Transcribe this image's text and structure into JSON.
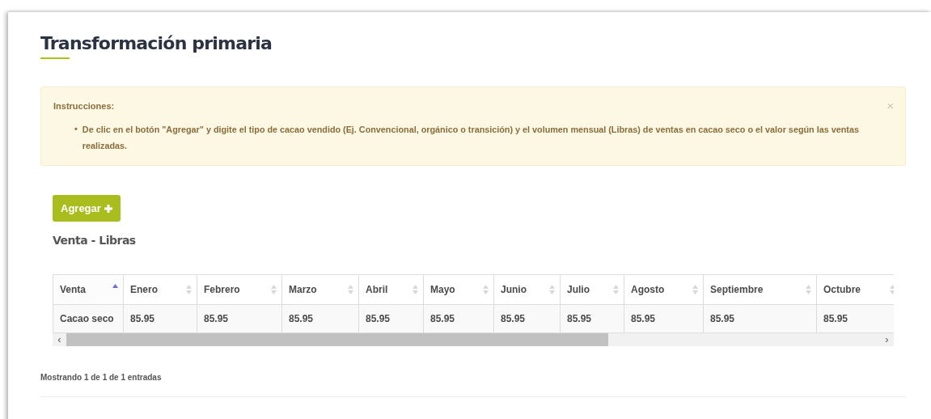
{
  "title": "Transformación primaria",
  "alert": {
    "heading": "Instrucciones:",
    "bullet": "•",
    "items": [
      "De clic en el botón \"Agregar\" y digite el tipo de cacao vendido (Ej. Convencional, orgánico o transición) y el volumen mensual (Libras) de ventas en cacao seco o el valor según las ventas realizadas."
    ],
    "close": "×"
  },
  "add_button": "Agregar",
  "subtitle": "Venta - Libras",
  "table": {
    "columns": [
      {
        "label": "Venta",
        "sorted": true
      },
      {
        "label": "Enero",
        "sorted": false
      },
      {
        "label": "Febrero",
        "sorted": false
      },
      {
        "label": "Marzo",
        "sorted": false
      },
      {
        "label": "Abril",
        "sorted": false
      },
      {
        "label": "Mayo",
        "sorted": false
      },
      {
        "label": "Junio",
        "sorted": false
      },
      {
        "label": "Julio",
        "sorted": false
      },
      {
        "label": "Agosto",
        "sorted": false
      },
      {
        "label": "Septiembre",
        "sorted": false
      },
      {
        "label": "Octubre",
        "sorted": false
      }
    ],
    "rows": [
      [
        "Cacao seco",
        "85.95",
        "85.95",
        "85.95",
        "85.95",
        "85.95",
        "85.95",
        "85.95",
        "85.95",
        "85.95",
        "85.95"
      ]
    ]
  },
  "scroll_left": "‹",
  "scroll_right": "›",
  "footer": "Mostrando 1 de 1 de 1 entradas"
}
